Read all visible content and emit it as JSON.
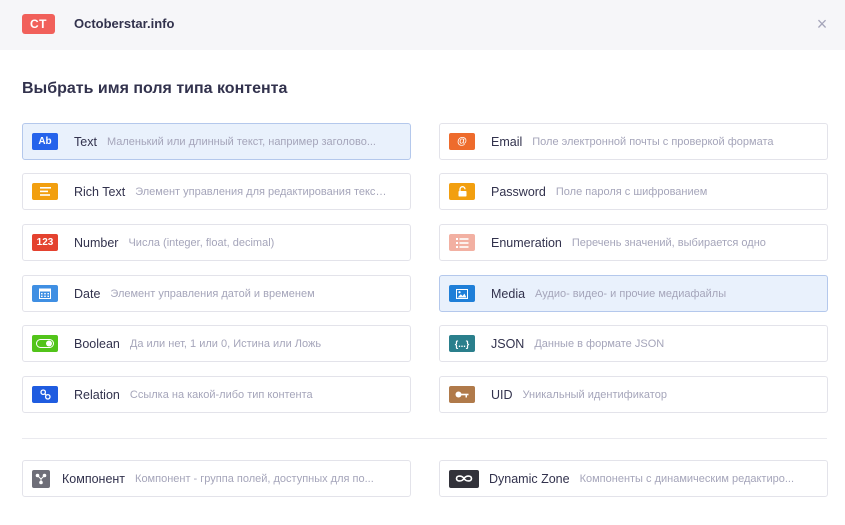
{
  "header": {
    "logo_text": "CT",
    "site_name": "Octoberstar.info",
    "close_symbol": "×"
  },
  "title": "Выбрать имя поля типа контента",
  "fields": [
    {
      "id": "text",
      "label": "Text",
      "description": "Маленький или длинный текст, например заголово...",
      "icon": "ab-text-icon",
      "icon_text": "Ab",
      "color": "#2563eb",
      "selected": true
    },
    {
      "id": "email",
      "label": "Email",
      "description": "Поле электронной почты с проверкой формата",
      "icon": "at-sign-icon",
      "icon_text": "@",
      "color": "#ee6b2c",
      "selected": false
    },
    {
      "id": "richtext",
      "label": "Rich Text",
      "description": "Элемент управления для редактирования текст...",
      "icon": "text-lines-icon",
      "icon_text": "",
      "color": "#f29f0f",
      "selected": false
    },
    {
      "id": "password",
      "label": "Password",
      "description": "Поле пароля с шифрованием",
      "icon": "lock-icon",
      "icon_text": "",
      "color": "#f29f0f",
      "selected": false
    },
    {
      "id": "number",
      "label": "Number",
      "description": "Числа (integer, float, decimal)",
      "icon": "number-123-icon",
      "icon_text": "123",
      "color": "#e4422f",
      "selected": false
    },
    {
      "id": "enumeration",
      "label": "Enumeration",
      "description": "Перечень значений, выбирается одно",
      "icon": "list-icon",
      "icon_text": "",
      "color": "#f2b0a2",
      "selected": false
    },
    {
      "id": "date",
      "label": "Date",
      "description": "Элемент управления датой и временем",
      "icon": "calendar-icon",
      "icon_text": "",
      "color": "#3f8fe3",
      "selected": false
    },
    {
      "id": "media",
      "label": "Media",
      "description": "Аудио- видео- и прочие медиафайлы",
      "icon": "image-icon",
      "icon_text": "",
      "color": "#1f7fd8",
      "selected": true
    },
    {
      "id": "boolean",
      "label": "Boolean",
      "description": "Да или нет, 1 или 0, Истина или Ложь",
      "icon": "toggle-icon",
      "icon_text": "",
      "color": "#52c41a",
      "selected": false
    },
    {
      "id": "json",
      "label": "JSON",
      "description": "Данные в формате JSON",
      "icon": "braces-icon",
      "icon_text": "{...}",
      "color": "#2a7f8c",
      "selected": false
    },
    {
      "id": "relation",
      "label": "Relation",
      "description": "Ссылка на какой-либо тип контента",
      "icon": "link-icon",
      "icon_text": "",
      "color": "#1f5ce0",
      "selected": false
    },
    {
      "id": "uid",
      "label": "UID",
      "description": "Уникальный идентификатор",
      "icon": "key-icon",
      "icon_text": "",
      "color": "#b07a4a",
      "selected": false
    },
    {
      "id": "component",
      "label": "Компонент",
      "description": "Компонент - группа полей, доступных для по...",
      "icon": "component-icon",
      "icon_text": "",
      "color": "#6e6e78",
      "selected": false
    },
    {
      "id": "dynamiczone",
      "label": "Dynamic Zone",
      "description": "Компоненты с динамическим редактиро...",
      "icon": "infinity-icon",
      "icon_text": "",
      "color": "#32323a",
      "selected": false
    }
  ]
}
